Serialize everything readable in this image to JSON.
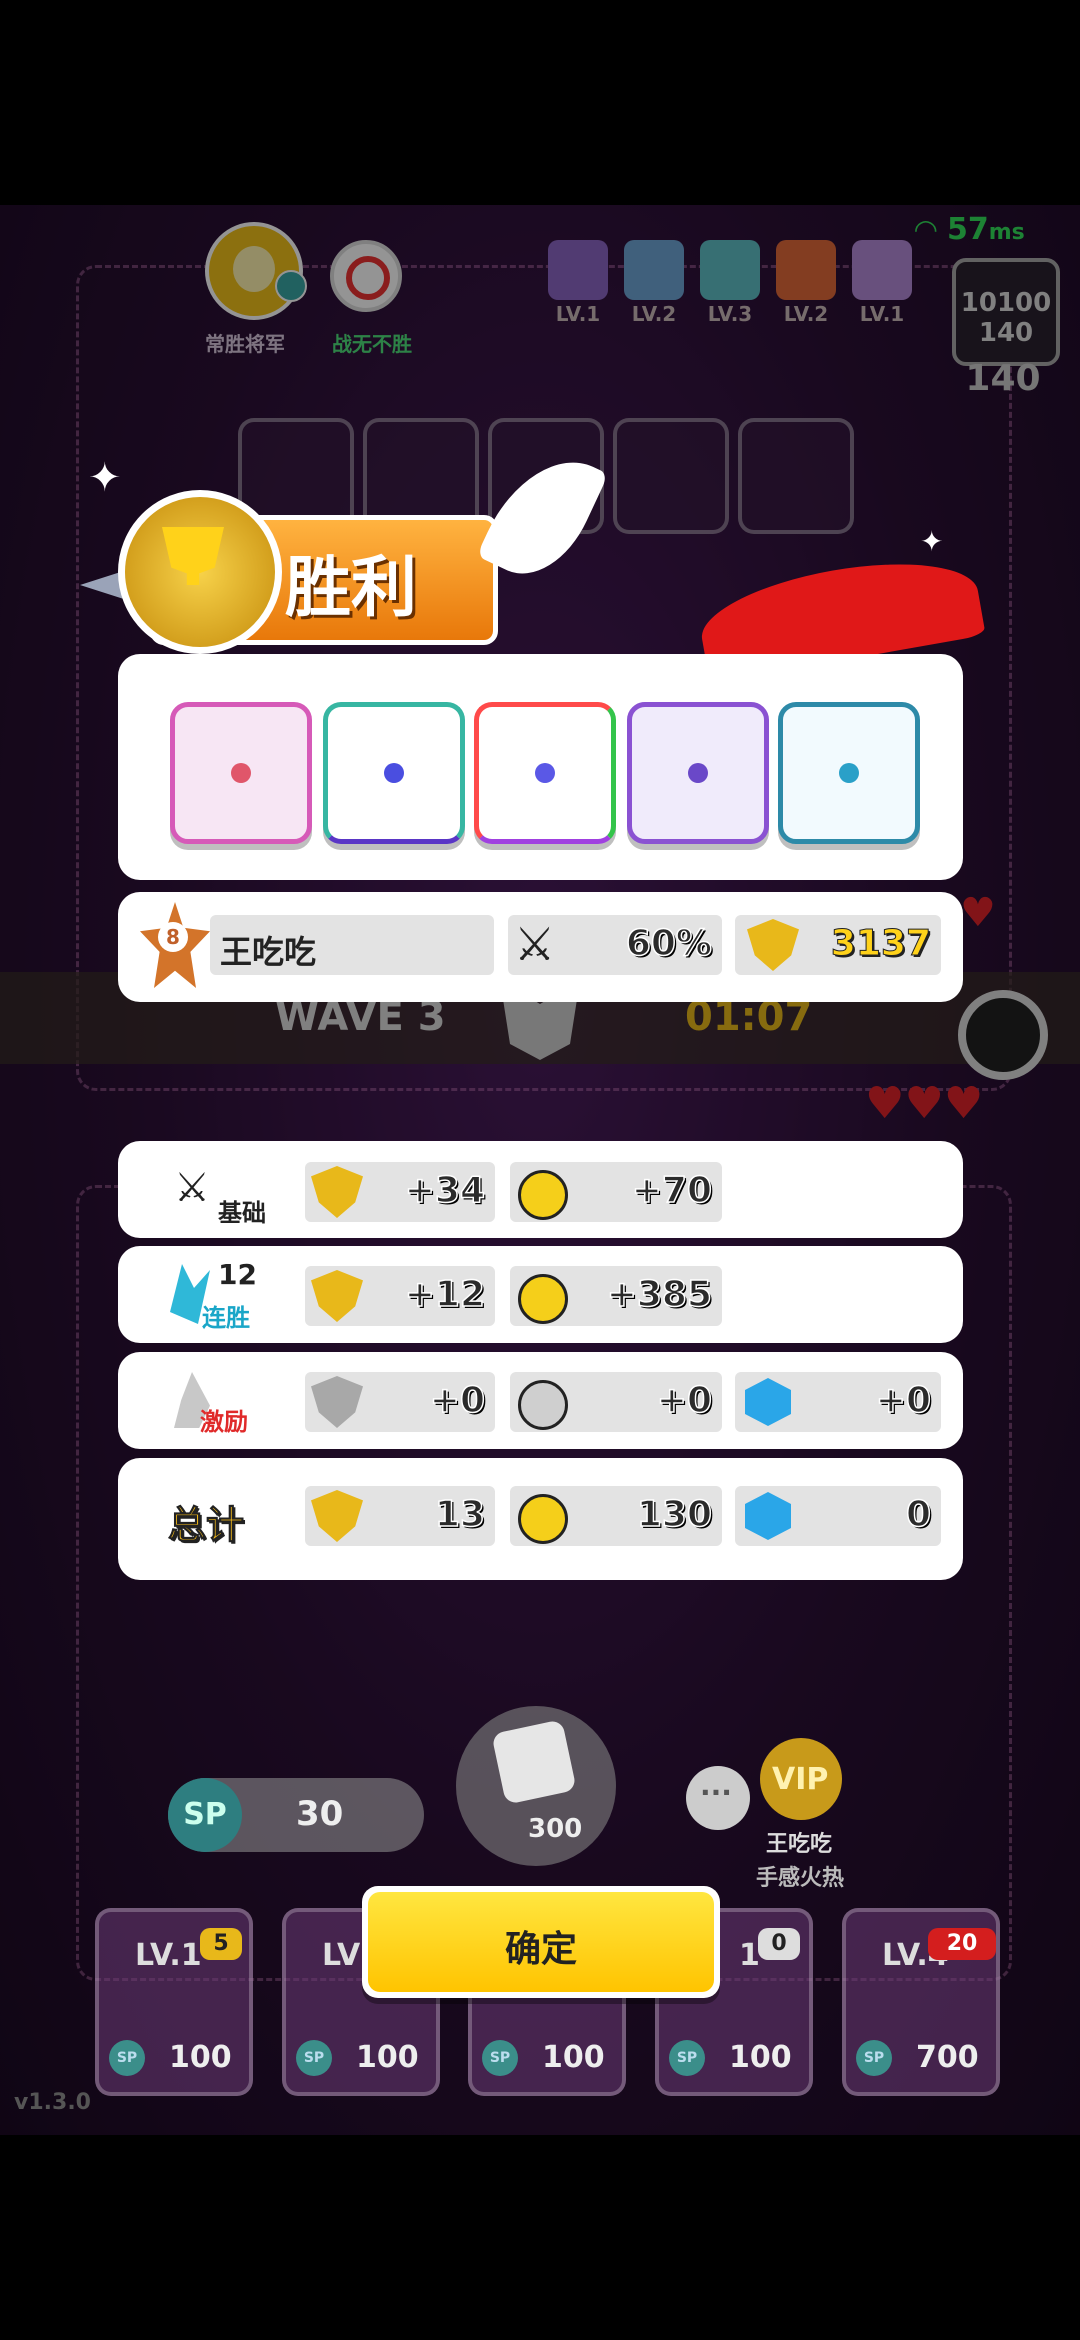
{
  "status": {
    "ping": "57",
    "ping_unit": "ms"
  },
  "top_bar": {
    "player_title": "常胜将军",
    "opponent_title": "战无不胜",
    "deck_levels": [
      "LV.1",
      "LV.2",
      "LV.3",
      "LV.2",
      "LV.1"
    ],
    "score_top": "10100",
    "score_mid": "140",
    "score_bottom": "140"
  },
  "board": {
    "wave": "WAVE 3",
    "timer": "01:07"
  },
  "result": {
    "banner": "胜利",
    "player_rank": "8",
    "player_name": "王吃吃",
    "win_rate": "60%",
    "trophies": "3137",
    "dice": [
      "pink-sword-die",
      "teal-hands-die",
      "rainbow-die",
      "purple-spiral-die",
      "blue-vortex-die"
    ]
  },
  "rewards": {
    "base": {
      "label": "基础",
      "trophy": "+34",
      "coin": "+70"
    },
    "streak": {
      "count": "12",
      "label": "连胜",
      "trophy": "+12",
      "coin": "+385"
    },
    "bonus": {
      "label": "激励",
      "trophy": "+0",
      "coin": "+0",
      "gem": "+0"
    },
    "total": {
      "label": "总计",
      "trophy": "13",
      "coin": "130",
      "gem": "0"
    }
  },
  "bottom": {
    "sp_label": "SP",
    "sp_value": "30",
    "spawn_cost": "300",
    "opponent_name": "王吃吃",
    "opponent_status": "手感火热",
    "vip": "VIP",
    "confirm": "确定",
    "cards": [
      {
        "level": "LV.1",
        "cost": "100",
        "badge": "5"
      },
      {
        "level": "LV",
        "cost": "100",
        "badge": ""
      },
      {
        "level": "",
        "cost": "100",
        "badge": ""
      },
      {
        "level": "1",
        "cost": "100",
        "badge": "0"
      },
      {
        "level": "LV.4",
        "cost": "700",
        "badge": "20"
      }
    ],
    "version": "v1.3.0"
  },
  "colors": {
    "gold": "#ffd21a",
    "confirm_yellow": "#ffd400",
    "banner_orange": "#f28a10",
    "stage_purple": "#2b1035"
  }
}
